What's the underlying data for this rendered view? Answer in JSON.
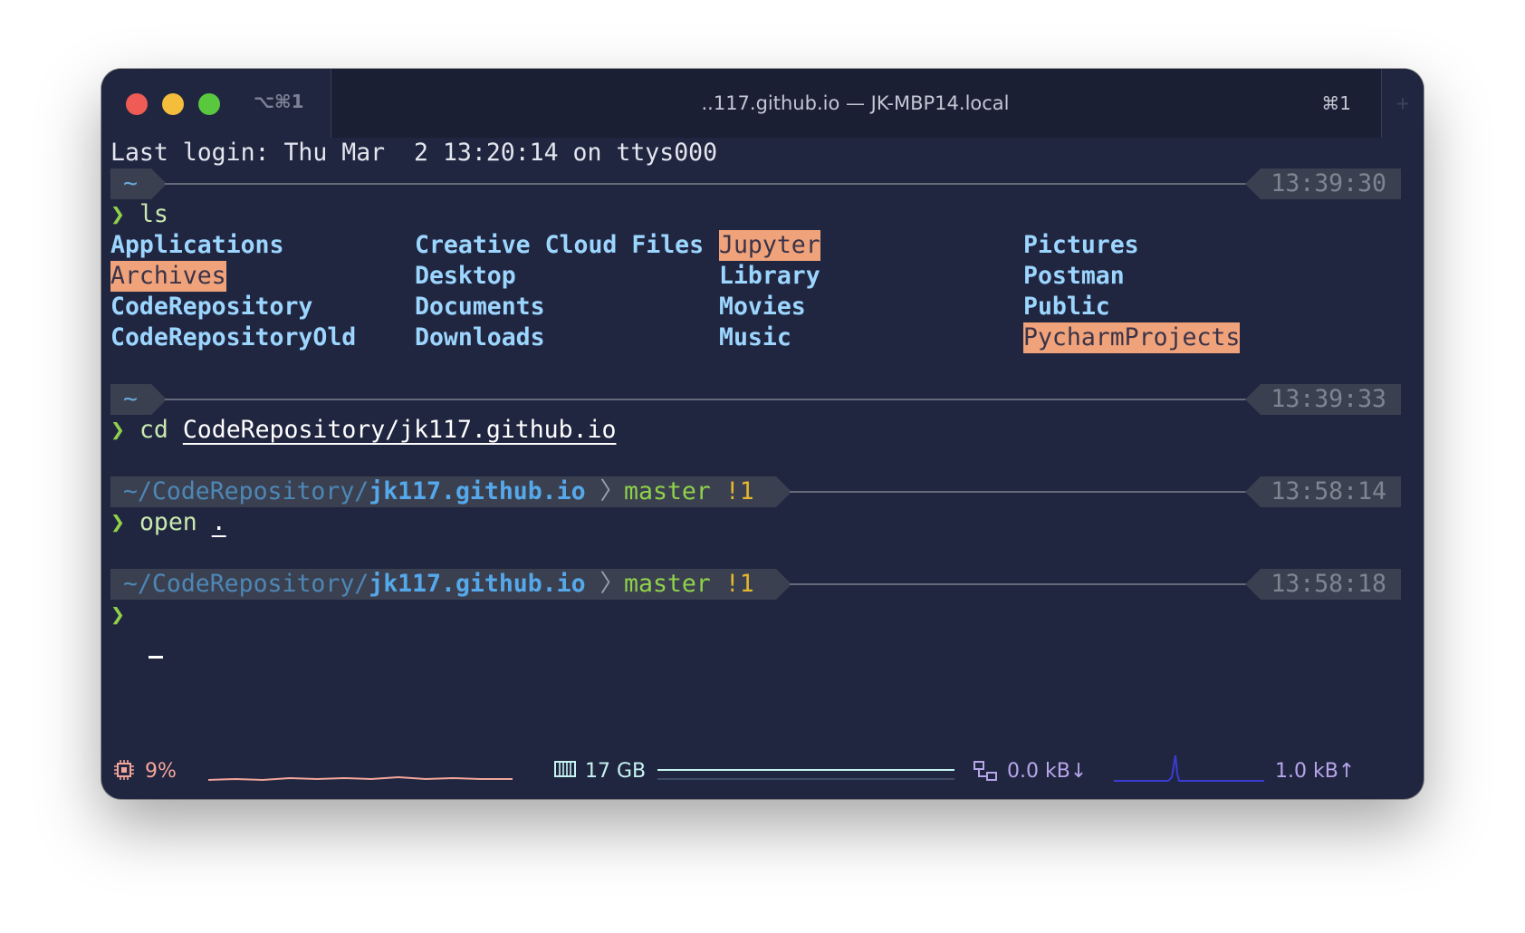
{
  "titlebar": {
    "tab_shortcut": "⌥⌘1",
    "window_title": "..117.github.io — JK-MBP14.local",
    "window_shortcut": "⌘1"
  },
  "terminal": {
    "last_login": "Last login: Thu Mar  2 13:20:14 on ttys000",
    "blocks": [
      {
        "cwd": "~",
        "time": "13:39:30",
        "command": "ls",
        "args": ""
      },
      {
        "cwd": "~",
        "time": "13:39:33",
        "command": "cd",
        "args": "CodeRepository/jk117.github.io"
      },
      {
        "cwd_prefix": "~/CodeRepository/",
        "cwd_repo": "jk117.github.io",
        "branch": "master",
        "git_status": "!1",
        "time": "13:58:14",
        "command": "open",
        "args": "."
      },
      {
        "cwd_prefix": "~/CodeRepository/",
        "cwd_repo": "jk117.github.io",
        "branch": "master",
        "git_status": "!1",
        "time": "13:58:18",
        "command": "",
        "args": ""
      }
    ],
    "prompt_symbol": "❯",
    "ls_columns": [
      [
        "Applications",
        "Archives",
        "CodeRepository",
        "CodeRepositoryOld"
      ],
      [
        "Creative Cloud Files",
        "Desktop",
        "Documents",
        "Downloads"
      ],
      [
        "Jupyter",
        "Library",
        "Movies",
        "Music"
      ],
      [
        "Pictures",
        "Postman",
        "Public",
        "PycharmProjects"
      ]
    ],
    "ls_highlighted": [
      "Archives",
      "Jupyter",
      "PycharmProjects"
    ]
  },
  "statusbar": {
    "cpu": "9%",
    "memory": "17 GB",
    "net_down": "0.0 kB↓",
    "net_up": "1.0 kB↑",
    "icons": {
      "cpu": "cpu-chip-icon",
      "memory": "memory-icon",
      "network": "network-icon"
    },
    "colors": {
      "cpu": "#f3a59b",
      "memory": "#c6f4f1",
      "network": "#b7a5ea",
      "net_graph": "#3b3bd6"
    }
  }
}
